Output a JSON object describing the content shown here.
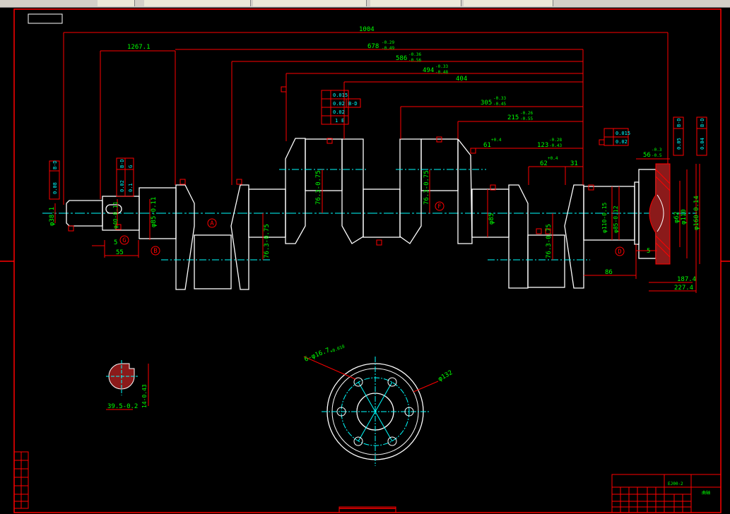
{
  "colors": {
    "frame": "#ff0000",
    "body": "#ffffff",
    "dim": "#00ff00",
    "center": "#00ffff",
    "text": "#00ff00",
    "hatch": "#ff0000"
  },
  "dims": {
    "overall": "1004",
    "d1267": "1267.1",
    "d678": "678",
    "d678_tol_up": "-0.29",
    "d678_tol_lo": "-0.49",
    "d586": "586",
    "d586_tol_up": "-0.36",
    "d586_tol_lo": "-0.56",
    "d494": "494",
    "d494_tol_up": "-0.33",
    "d494_tol_lo": "-0.48",
    "d404": "404",
    "d305": "305",
    "d305_tol_up": "-0.33",
    "d305_tol_lo": "-0.45",
    "d215": "215",
    "d215_tol_up": "-0.26",
    "d215_tol_lo": "-0.55",
    "d61": "61",
    "d61_tol": "+0.4",
    "d123": "123",
    "d123_tol_up": "-0.28",
    "d123_tol_lo": "-0.43",
    "d62": "62",
    "d62_tol": "+0.4",
    "d31": "31",
    "d56": "56",
    "d56_tol_up": "-0.3",
    "d56_tol_lo": "-0.5",
    "d5a": "5",
    "d55": "55",
    "d86": "86",
    "d5b": "5",
    "d187": "187.4",
    "d227": "227.4",
    "r7630": "76.3-0.75",
    "r7631": "76.3-0.75",
    "r7632": "76.3-0.75",
    "r7633": "76.3-0.75",
    "phi38": "φ38.1",
    "phi40": "φ40-0.11",
    "phi85a": "φ85-0.11",
    "phi85b": "φ85",
    "phi110a": "φ110-0.15",
    "phi85c": "φ85-0.12",
    "phi62": "φ62",
    "phi110b": "φ110",
    "phi160": "φ160-0.14",
    "key_w": "39.5-0.2",
    "key_d": "14-0.43",
    "holes": "6-φ16.7",
    "holes_tol": "+0.018",
    "pcd": "φ132"
  },
  "gtol": {
    "left_run": "/",
    "left_run_v": "0.08",
    "left_run_d": "B-D",
    "shaft_sym": "=",
    "shaft_sym_v": "0.02",
    "shaft_sym_d": "B-D",
    "shaft_sym2_v": "0.1",
    "shaft_sym2_d": "G",
    "mid_circ": "○",
    "mid_circ_v": "0.015",
    "mid_cyl": "⌭",
    "mid_cyl_v": "0.02",
    "mid_cyl_d": "B-D",
    "mid_par": "//",
    "mid_par_v": "0.02",
    "mid_pos": "⌖",
    "mid_pos_v": "1",
    "mid_pos_d": "E",
    "right_circ_v": "0.015",
    "right_cyl_v": "0.02",
    "r1_v": "0.05",
    "r1_d": "B-D",
    "r2_v": "0.04",
    "r2_d": "B-D"
  },
  "datums": {
    "A": "A",
    "B": "B",
    "D": "D",
    "F": "F",
    "G": "G"
  },
  "title_block": {
    "drawing_no": "EJ00-2",
    "part": "曲轴",
    "small": "比例"
  }
}
